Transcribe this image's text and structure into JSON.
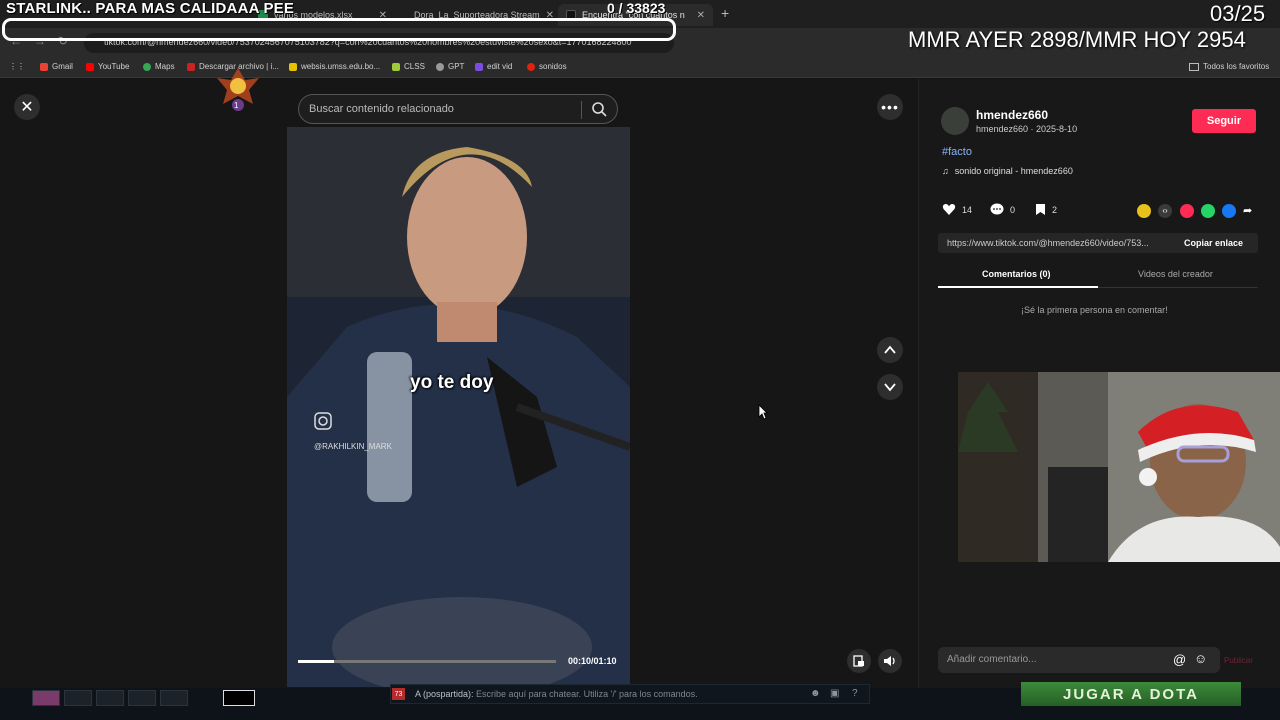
{
  "browser": {
    "tabs": [
      {
        "label": "varios modelos.xlsx",
        "active": false
      },
      {
        "label": "Dora_La_Suporteadora Stream",
        "active": false
      },
      {
        "label": "Encuentra \"con cuantos n",
        "active": true
      }
    ],
    "url": "tiktok.com/@hmendez660/video/7537024567075103782?q=con%20cuantos%20hombres%20estuviste%20sexo&t=1770168224800",
    "bookmarks": [
      "Gmail",
      "YouTube",
      "Maps",
      "Descargar archivo | i...",
      "websis.umss.edu.bo...",
      "CLSS",
      "GPT",
      "edit vid",
      "sonidos"
    ],
    "all_favorites": "Todos los favoritos"
  },
  "overlay": {
    "starlink_text": "STARLINK.. PARA MAS CALIDAAA PEE",
    "counter": "0  / 33823",
    "date": "03/25",
    "mmr": "MMR AYER 2898/MMR HOY 2954",
    "badge_number": "1"
  },
  "tiktok": {
    "search_placeholder": "Buscar contenido relacionado",
    "caption": "yo te doy",
    "watermark": "@RAKHILKIN_MARK",
    "time": "00:10/01:10",
    "progress": 0.14,
    "author": {
      "username": "hmendez660",
      "meta": "hmendez660 · 2025-8-10",
      "follow_label": "Seguir"
    },
    "hashtag": "#facto",
    "sound": "sonido original - hmendez660",
    "stats": {
      "likes": "14",
      "comments": "0",
      "saves": "2"
    },
    "link": "https://www.tiktok.com/@hmendez660/video/753...",
    "copy_label": "Copiar enlace",
    "tabs": [
      "Comentarios (0)",
      "Videos del creador"
    ],
    "no_comments": "¡Sé la primera persona en comentar!",
    "comment_placeholder": "Añadir comentario...",
    "publish_label": "Publicar"
  },
  "game": {
    "chat_badge": "73",
    "chat_prefix": "A (pospartida):",
    "chat_placeholder": "Escribe aquí para chatear. Utiliza '/' para los comandos.",
    "play_button": "JUGAR A DOTA"
  },
  "colors": {
    "accent": "#fe2c55",
    "link": "#8ab4f8",
    "dota_green": "#3c8a3a"
  }
}
